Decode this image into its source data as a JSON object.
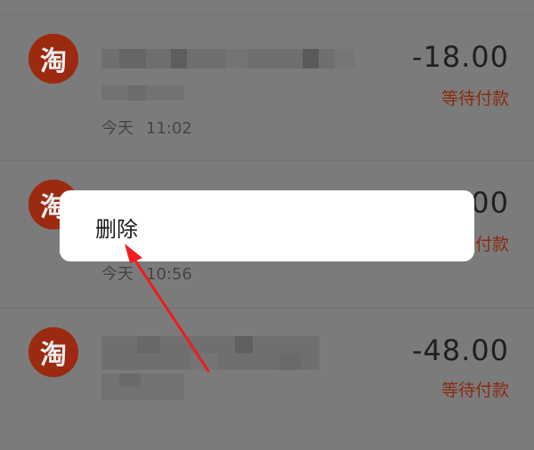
{
  "orders": [
    {
      "store_icon": "taobao-logo-icon",
      "store_glyph": "淘",
      "amount": "-18.00",
      "status": "等待付款",
      "date": "今天",
      "time": "11:02"
    },
    {
      "store_icon": "taobao-logo-icon",
      "store_glyph": "淘",
      "amount": "-18.00",
      "status": "等待付款",
      "date": "今天",
      "time": "10:56"
    },
    {
      "store_icon": "taobao-logo-icon",
      "store_glyph": "淘",
      "amount": "-48.00",
      "status": "等待付款",
      "date": "",
      "time": ""
    }
  ],
  "context_menu": {
    "items": [
      {
        "label": "删除"
      }
    ]
  },
  "annotation": {
    "icon": "red-arrow-icon",
    "color": "#ee1c1c"
  },
  "colors": {
    "overlay": "#7b7b7b",
    "brand": "#9c2a10",
    "status": "#8a2a12",
    "popup": "#ffffff"
  }
}
